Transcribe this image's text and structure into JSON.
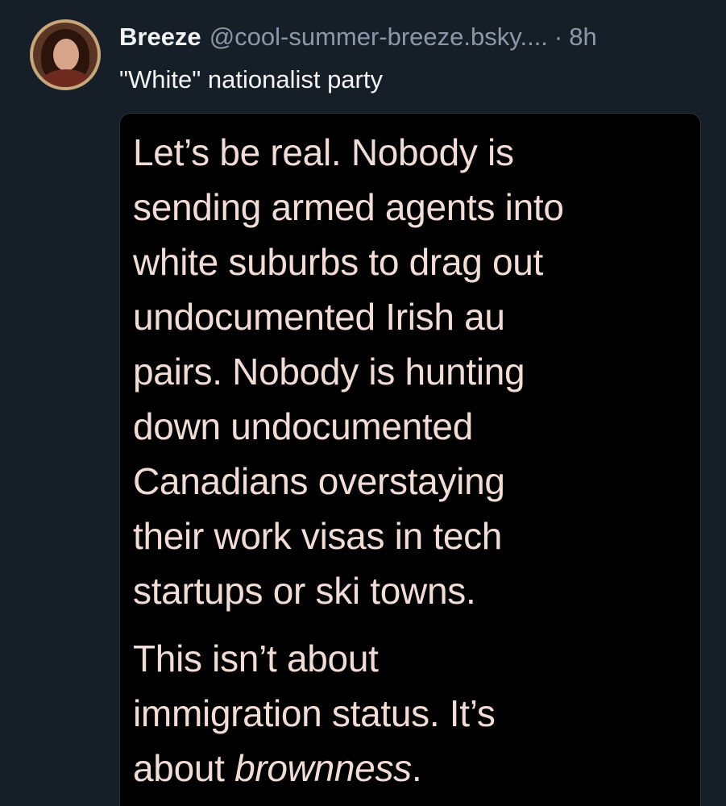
{
  "post": {
    "author": {
      "display_name": "Breeze",
      "handle": "@cool-summer-breeze.bsky....",
      "avatar_icon": "profile-photo"
    },
    "separator": "·",
    "timestamp": "8h",
    "text": "\"White\" nationalist party",
    "embed_image": {
      "paragraph_1": "Let’s be real. Nobody is\nsending armed agents into\nwhite suburbs to drag out\nundocumented Irish au\npairs. Nobody is hunting\ndown undocumented\nCanadians overstaying\ntheir work visas in tech\nstartups or ski towns.",
      "paragraph_2_lead": "This isn’t about\nimmigration status. It’s\nabout ",
      "paragraph_2_emphasis": "brownness",
      "paragraph_2_end": "."
    }
  },
  "colors": {
    "background": "#161e27",
    "primary_text": "#f1f3f5",
    "secondary_text": "#8b98a9",
    "meme_background": "#000000",
    "meme_text": "#f2dcd6"
  }
}
